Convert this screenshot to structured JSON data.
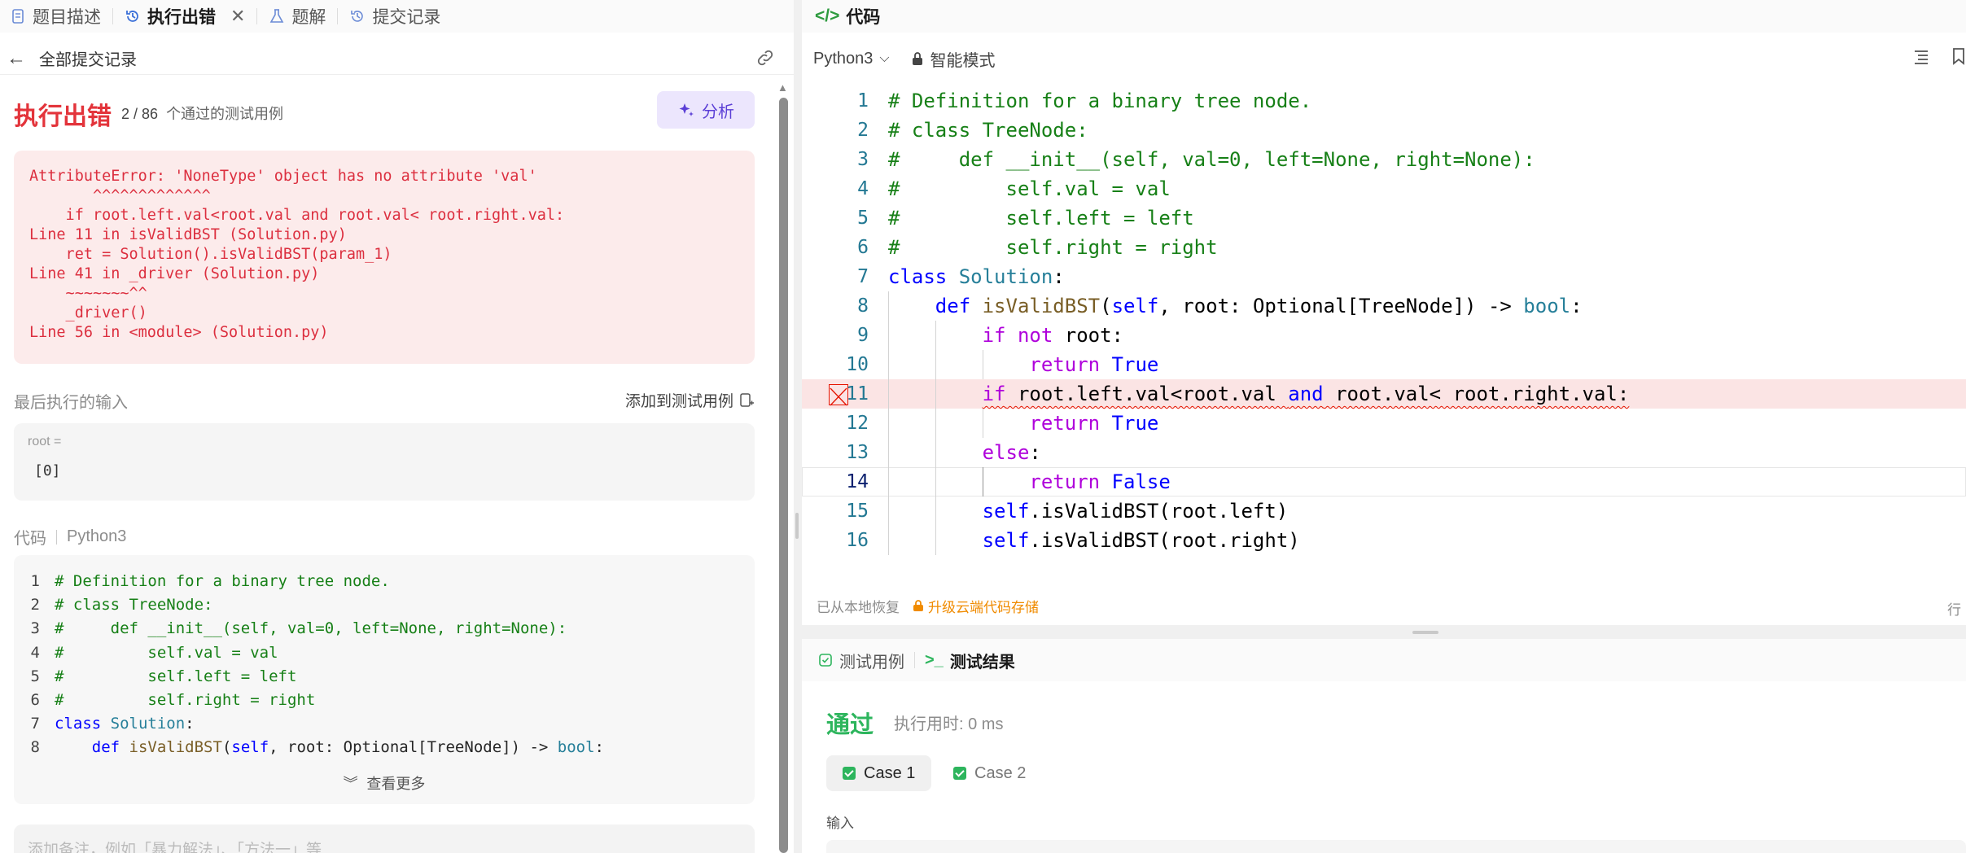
{
  "left_tabs": [
    {
      "label": "题目描述",
      "icon": "document-icon",
      "active": false
    },
    {
      "label": "执行出错",
      "icon": "history-icon",
      "active": true
    },
    {
      "label": "题解",
      "icon": "flask-icon",
      "active": false
    },
    {
      "label": "提交记录",
      "icon": "history-icon",
      "active": false
    }
  ],
  "back_label": "全部提交记录",
  "result": {
    "status": "执行出错",
    "passed": "2 / 86",
    "passed_suffix": "个通过的测试用例",
    "analyze_label": "分析"
  },
  "error_text": "AttributeError: 'NoneType' object has no attribute 'val'\n       ^^^^^^^^^^^^^\n    if root.left.val<root.val and root.val< root.right.val:\nLine 11 in isValidBST (Solution.py)\n    ret = Solution().isValidBST(param_1)\nLine 41 in _driver (Solution.py)\n    ~~~~~~~^^\n    _driver()\nLine 56 in <module> (Solution.py)",
  "last_input": {
    "section_label": "最后执行的输入",
    "add_test_label": "添加到测试用例",
    "param_label": "root =",
    "param_value": "[0]"
  },
  "submitted_code": {
    "section_label": "代码",
    "language": "Python3",
    "more_label": "查看更多",
    "lines": [
      "# Definition for a binary tree node.",
      "# class TreeNode:",
      "#     def __init__(self, val=0, left=None, right=None):",
      "#         self.val = val",
      "#         self.left = left",
      "#         self.right = right",
      "class Solution:",
      "    def isValidBST(self, root: Optional[TreeNode]) -> bool:"
    ]
  },
  "note_placeholder": "添加备注，例如「暴力解法」、「方法一」等",
  "editor": {
    "title": "代码",
    "language": "Python3",
    "mode_label": "智能模式",
    "restored_label": "已从本地恢复",
    "upgrade_label": "升级云端代码存储",
    "row_label": "行",
    "error_line": 11,
    "cursor_line": 14,
    "lines": [
      "# Definition for a binary tree node.",
      "# class TreeNode:",
      "#     def __init__(self, val=0, left=None, right=None):",
      "#         self.val = val",
      "#         self.left = left",
      "#         self.right = right",
      "class Solution:",
      "    def isValidBST(self, root: Optional[TreeNode]) -> bool:",
      "        if not root:",
      "            return True",
      "        if root.left.val<root.val and root.val< root.right.val:",
      "            return True",
      "        else:",
      "            return False",
      "        self.isValidBST(root.left)",
      "        self.isValidBST(root.right)"
    ]
  },
  "test_panel": {
    "tabs": [
      {
        "label": "测试用例",
        "icon": "checkbox-icon",
        "active": false
      },
      {
        "label": "测试结果",
        "icon": "terminal-icon",
        "active": true
      }
    ],
    "status": "通过",
    "time_label": "执行用时: 0 ms",
    "cases": [
      "Case 1",
      "Case 2"
    ],
    "input_label": "输入"
  },
  "colors": {
    "error_red": "#e3343b",
    "pass_green": "#2db55d",
    "analyze_purple": "#5b3fd6",
    "upgrade_orange": "#f08b00"
  }
}
